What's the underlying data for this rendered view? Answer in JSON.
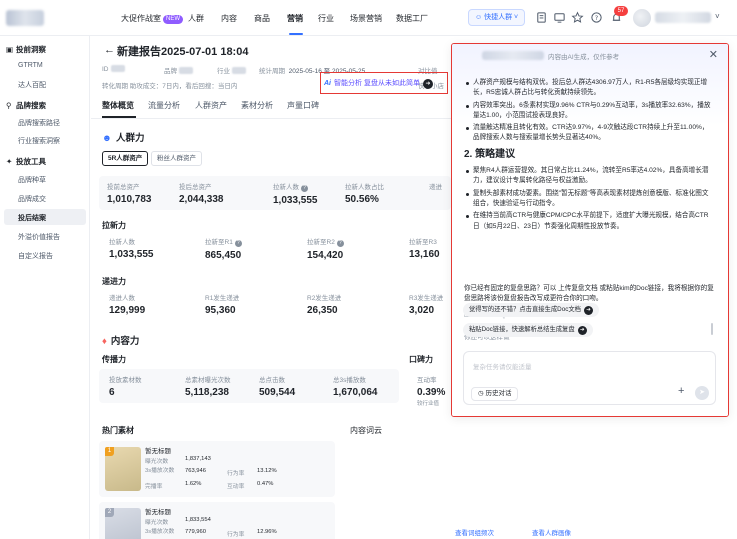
{
  "topnav": {
    "items": [
      "大促作战室",
      "人群",
      "内容",
      "商品",
      "营销",
      "行业",
      "场景营销",
      "数据工厂"
    ],
    "new_tag": "NEW",
    "quick_button": "快捷人群",
    "notif_count": "57"
  },
  "sidebar": {
    "groups": [
      {
        "label": "投前洞察",
        "items": [
          "GTRTM",
          "达人百配"
        ]
      },
      {
        "label": "品牌搜索",
        "items": [
          "品牌搜索路径",
          "行业搜索洞察"
        ]
      },
      {
        "label": "投放工具",
        "items": [
          "品牌种草",
          "品牌成交",
          "投后结案",
          "外溢价值报告",
          "自定义报告"
        ]
      }
    ],
    "active_item": "投后结案"
  },
  "report": {
    "title": "新建报告2025-07-01 18:04",
    "ai_chip_logo": "Ai",
    "ai_chip_text": "智能分析 复盘从未如此简单",
    "meta_id_label": "ID",
    "meta_brand_label": "品牌",
    "meta_industry_label": "行业",
    "meta_period_label": "统计周期",
    "meta_period_value": "2025-05-16 至 2025-05-25",
    "meta_compare_label": "对比值",
    "meta_row2": "转化周期  助攻成交：7日内，看后回搜：当日内",
    "quick_label": "快手小店",
    "tabs": [
      "整体概览",
      "流量分析",
      "人群资产",
      "素材分析",
      "声量口碑"
    ]
  },
  "crowd": {
    "title": "人群力",
    "segments": [
      "5R人群资产",
      "粉丝人群资产"
    ],
    "row1": [
      {
        "label": "投前总资产",
        "value": "1,010,783"
      },
      {
        "label": "投后总资产",
        "value": "2,044,338"
      },
      {
        "label": "拉新人数",
        "value": "1,033,555"
      },
      {
        "label": "拉新人数占比",
        "value": "50.56%"
      },
      {
        "label": "递进",
        "value": ""
      }
    ],
    "pull_title": "拉新力",
    "row2": [
      {
        "label": "拉新人数",
        "value": "1,033,555"
      },
      {
        "label": "拉新至R1",
        "value": "865,450"
      },
      {
        "label": "拉新至R2",
        "value": "154,420"
      },
      {
        "label": "拉新至R3",
        "value": "13,160"
      }
    ],
    "advance_title": "递进力",
    "row3": [
      {
        "label": "递进人数",
        "value": "129,999"
      },
      {
        "label": "R1发生递进",
        "value": "95,360"
      },
      {
        "label": "R2发生递进",
        "value": "26,350"
      },
      {
        "label": "R3发生递进",
        "value": "3,020"
      }
    ]
  },
  "content": {
    "title": "内容力",
    "spread_title": "传播力",
    "reputation_title": "口碑力",
    "row4": [
      {
        "label": "投放素材数",
        "value": "6"
      },
      {
        "label": "总素材曝光次数",
        "value": "5,118,238"
      },
      {
        "label": "总点击数",
        "value": "509,544"
      },
      {
        "label": "总3s播放数",
        "value": "1,670,064"
      }
    ],
    "interact_label": "互动率",
    "interact_value": "0.39%",
    "interact_sub": "较行业值",
    "hot_title": "热门素材",
    "words_title": "内容词云",
    "hot_cards": [
      {
        "rank": "1",
        "title": "暂无标题",
        "r1l": "曝光次数",
        "r1v": "1,837,143",
        "r2l": "3s播放次数",
        "r2v": "763,946",
        "r2l2": "行为率",
        "r2v2": "13.12%",
        "r3l": "完播率",
        "r3v": "1.62%",
        "r3l2": "互动率",
        "r3v2": "0.47%"
      },
      {
        "rank": "2",
        "title": "暂无标题",
        "r1l": "曝光次数",
        "r1v": "1,833,554",
        "r2l": "3s播放次数",
        "r2v": "779,960",
        "r2l2": "行为率",
        "r2v2": "12.96%"
      }
    ],
    "bottom_links": [
      "查看词组频次",
      "查看人群画像"
    ]
  },
  "ai_panel": {
    "header_note": "内容由AI生成，仅作参考",
    "bullets_1": [
      "人群资产规模与结构双优。投后总人群达4306.97万人，R1-R5各层级均实现正增长，R5忠诚人群占比与转化贡献持续领先。",
      "内容效率突出。6条素材实现9.96% CTR与0.29%互动率，3s播放率32.63%，播放量达1.00，小范围试投表现良好。",
      "流量触达精准且转化有效。CTR达9.97%，4-9次触达段CTR持续上升至11.00%，品牌搜索人数与搜索量增长势头显著达40%。"
    ],
    "section2_title": "2. 策略建议",
    "bullets_2": [
      "聚焦R4人群运营提效。其日常占比11.24%，流转至R5率达4.02%，具备高增长潜力，建议设计专属转化路径与权益激励。",
      "复制头部素材成功要素。围绕\"暂无标题\"等高表现素材提炼创意模版、标准化图文组合，快速验证与行动指令。",
      "在维持当前高CTR与健康CPM/CPC水平前提下，适度扩大曝光规模，结合高CTR日（如5月22日、23日）节奏强化周期性投放节奏。"
    ],
    "question": "你已经有固定的复盘思路？可以 上传复盘文档 或粘贴kim的Doc链接，我将根据你的复盘思路将该份复盘报告改写成更符合你的口吻。",
    "ask_label": "你还可以这样做",
    "suggestions": [
      "觉得写的还不错？点击直接生成Doc文档",
      "粘贴Doc链接，快速解析总结生成复盘"
    ],
    "input_placeholder": "复杂任务请仅能适量",
    "history_button": "历史对话"
  }
}
